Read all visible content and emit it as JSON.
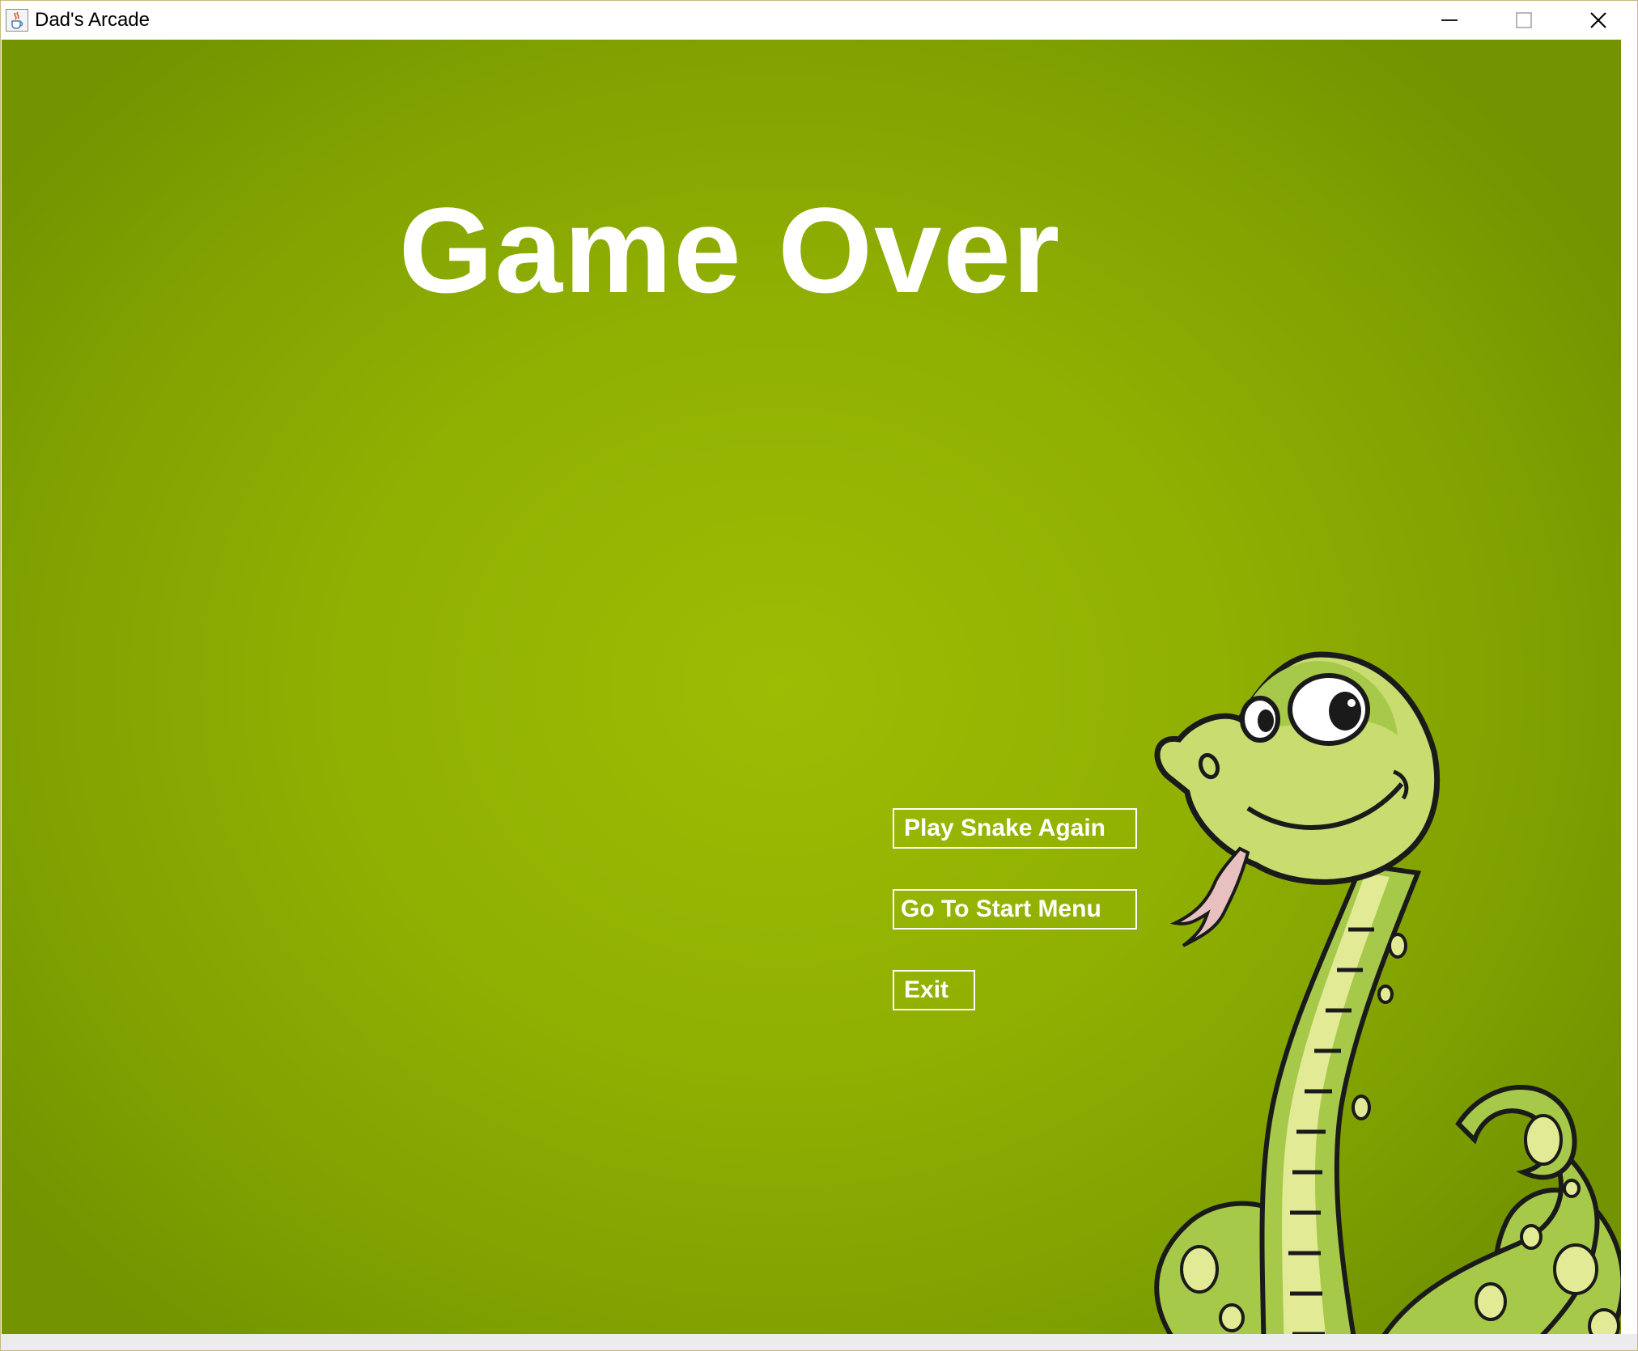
{
  "window": {
    "title": "Dad's Arcade",
    "icon": "java-cup-icon",
    "controls": [
      "minimize-icon",
      "maximize-icon",
      "close-icon"
    ]
  },
  "game": {
    "heading": "Game Over",
    "buttons": {
      "play_again": "Play Snake Again",
      "start_menu": "Go To Start Menu",
      "exit": "Exit"
    },
    "illustration": "cartoon-snake",
    "colors": {
      "background": "#8cab02",
      "text": "#ffffff",
      "snake_body": "#a6c94a",
      "snake_belly": "#e2ea96"
    }
  }
}
